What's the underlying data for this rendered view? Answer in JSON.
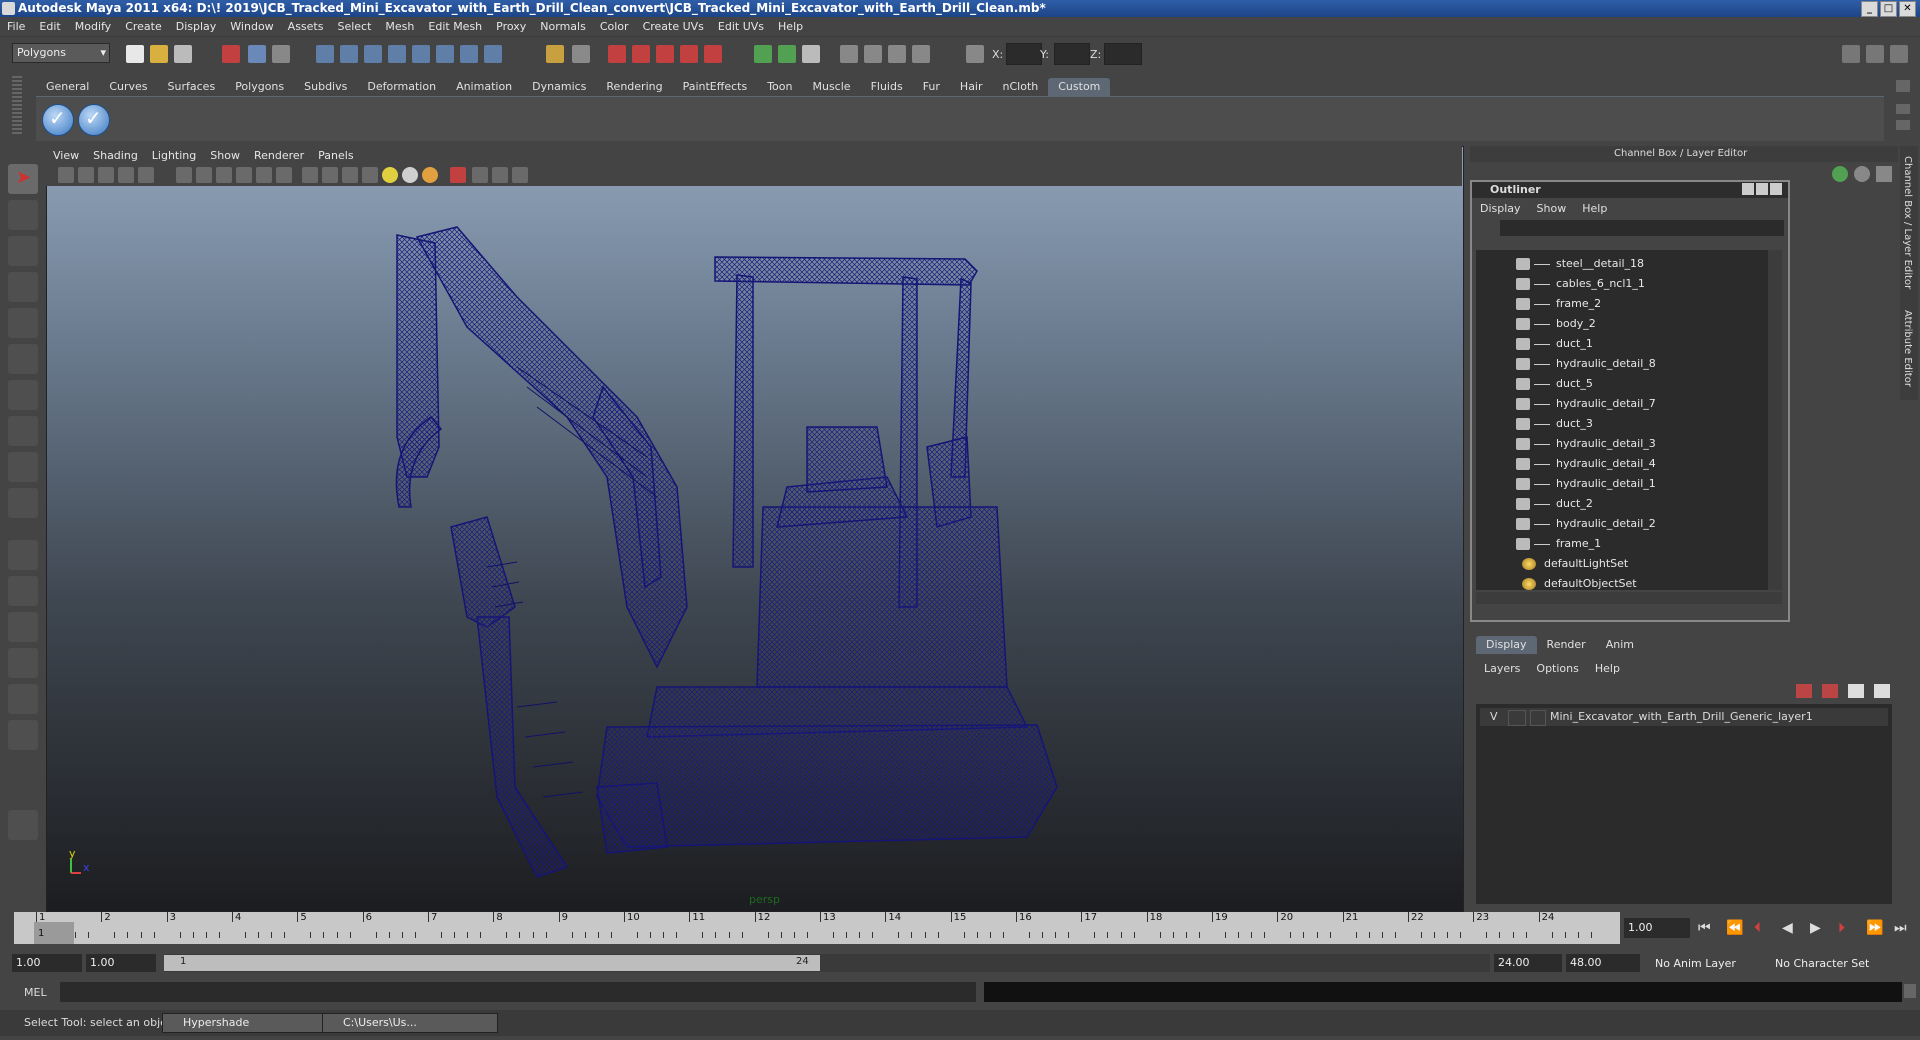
{
  "window": {
    "title": "Autodesk Maya 2011 x64: D:\\! 2019\\JCB_Tracked_Mini_Excavator_with_Earth_Drill_Clean_convert\\JCB_Tracked_Mini_Excavator_with_Earth_Drill_Clean.mb*"
  },
  "menubar": [
    "File",
    "Edit",
    "Modify",
    "Create",
    "Display",
    "Window",
    "Assets",
    "Select",
    "Mesh",
    "Edit Mesh",
    "Proxy",
    "Normals",
    "Color",
    "Create UVs",
    "Edit UVs",
    "Help"
  ],
  "statusline": {
    "mode": "Polygons",
    "x_label": "X:",
    "y_label": "Y:",
    "z_label": "Z:"
  },
  "shelf": {
    "tabs": [
      "General",
      "Curves",
      "Surfaces",
      "Polygons",
      "Subdivs",
      "Deformation",
      "Animation",
      "Dynamics",
      "Rendering",
      "PaintEffects",
      "Toon",
      "Muscle",
      "Fluids",
      "Fur",
      "Hair",
      "nCloth",
      "Custom"
    ],
    "active_tab": "Custom"
  },
  "viewport": {
    "menu": [
      "View",
      "Shading",
      "Lighting",
      "Show",
      "Renderer",
      "Panels"
    ],
    "camera_label": "persp",
    "axis_y": "y",
    "axis_x": "x",
    "wire_color": "#17176e"
  },
  "channelbox": {
    "title": "Channel Box / Layer Editor",
    "side_tab_1": "Channel Box / Layer Editor",
    "side_tab_2": "Attribute Editor"
  },
  "outliner": {
    "title": "Outliner",
    "menu": [
      "Display",
      "Show",
      "Help"
    ],
    "items": [
      {
        "label": "steel__detail_18",
        "type": "mesh"
      },
      {
        "label": "cables_6_ncl1_1",
        "type": "mesh"
      },
      {
        "label": "frame_2",
        "type": "mesh"
      },
      {
        "label": "body_2",
        "type": "mesh"
      },
      {
        "label": "duct_1",
        "type": "mesh"
      },
      {
        "label": "hydraulic_detail_8",
        "type": "mesh"
      },
      {
        "label": "duct_5",
        "type": "mesh"
      },
      {
        "label": "hydraulic_detail_7",
        "type": "mesh"
      },
      {
        "label": "duct_3",
        "type": "mesh"
      },
      {
        "label": "hydraulic_detail_3",
        "type": "mesh"
      },
      {
        "label": "hydraulic_detail_4",
        "type": "mesh"
      },
      {
        "label": "hydraulic_detail_1",
        "type": "mesh"
      },
      {
        "label": "duct_2",
        "type": "mesh"
      },
      {
        "label": "hydraulic_detail_2",
        "type": "mesh"
      },
      {
        "label": "frame_1",
        "type": "mesh"
      },
      {
        "label": "defaultLightSet",
        "type": "set"
      },
      {
        "label": "defaultObjectSet",
        "type": "set"
      }
    ]
  },
  "layer_editor": {
    "tabs": [
      "Display",
      "Render",
      "Anim"
    ],
    "active_tab": "Display",
    "menu": [
      "Layers",
      "Options",
      "Help"
    ],
    "layers": [
      {
        "visible": "V",
        "name": "Mini_Excavator_with_Earth_Drill_Generic_layer1"
      }
    ]
  },
  "timeslider": {
    "ticks": [
      "1",
      "2",
      "3",
      "4",
      "5",
      "6",
      "7",
      "8",
      "9",
      "10",
      "11",
      "12",
      "13",
      "14",
      "15",
      "16",
      "17",
      "18",
      "19",
      "20",
      "21",
      "22",
      "23",
      "24"
    ],
    "current_frame": "1.00",
    "current_marker": "1"
  },
  "rangeslider": {
    "start": "1.00",
    "start2": "1.00",
    "range_start_label": "1",
    "range_end_label": "24",
    "end": "24.00",
    "end2": "48.00",
    "anim_layer": "No Anim Layer",
    "char_set": "No Character Set"
  },
  "cmdline": {
    "label": "MEL"
  },
  "helpline": {
    "text": "Select Tool: select an object",
    "tasks": [
      "Hypershade",
      "C:\\Users\\Us..."
    ]
  }
}
